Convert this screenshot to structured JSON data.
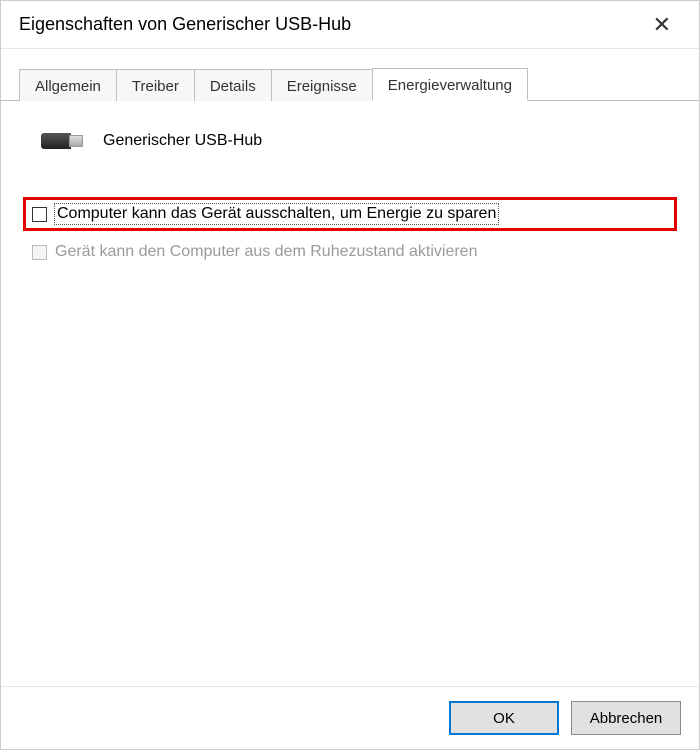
{
  "window": {
    "title": "Eigenschaften von Generischer USB-Hub"
  },
  "tabs": {
    "general": "Allgemein",
    "driver": "Treiber",
    "details": "Details",
    "events": "Ereignisse",
    "power": "Energieverwaltung"
  },
  "device": {
    "name": "Generischer USB-Hub"
  },
  "options": {
    "allow_off": "Computer kann das Gerät ausschalten, um Energie zu sparen",
    "allow_wake": "Gerät kann den Computer aus dem Ruhezustand aktivieren"
  },
  "buttons": {
    "ok": "OK",
    "cancel": "Abbrechen"
  }
}
